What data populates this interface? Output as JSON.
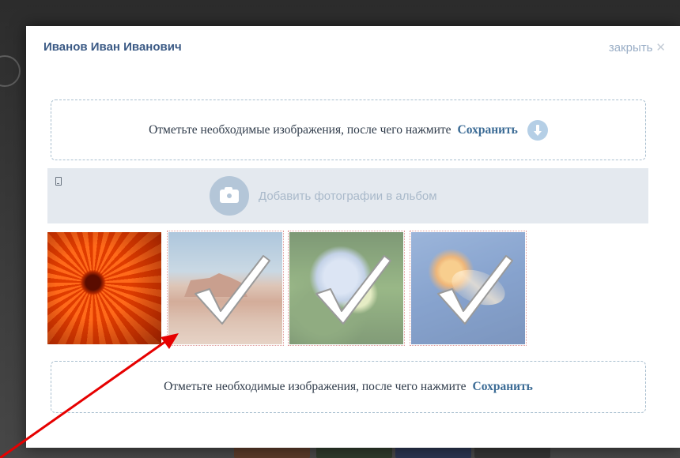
{
  "modal": {
    "title": "Иванов Иван Иванович",
    "close_label": "закрыть"
  },
  "top_hint": {
    "text": "Отметьте необходимые изображения, после чего нажмите",
    "save_label": "Сохранить"
  },
  "add_photos": {
    "label": "Добавить фотографии в альбом"
  },
  "photos": [
    {
      "name": "flower",
      "selected": false
    },
    {
      "name": "desert",
      "selected": true
    },
    {
      "name": "hydrangea",
      "selected": true
    },
    {
      "name": "jellyfish",
      "selected": true
    }
  ],
  "bottom_hint": {
    "text": "Отметьте необходимые изображения, после чего нажмите",
    "save_label": "Сохранить"
  },
  "colors": {
    "title": "#3b5a85",
    "save_link": "#3b6b95",
    "band": "#e4e9ef",
    "annotation_arrow": "#e60000"
  },
  "icons": [
    "close-icon",
    "save-icon",
    "mobile-icon",
    "camera-icon",
    "checkmark-icon"
  ]
}
